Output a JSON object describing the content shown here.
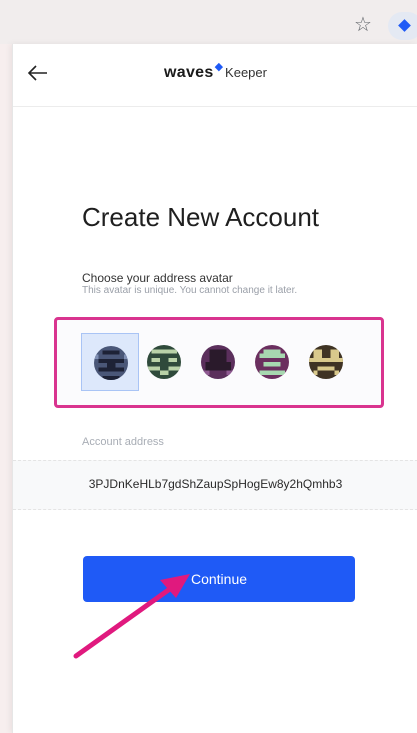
{
  "browser": {
    "icons": [
      "star-icon",
      "waves-extension-icon"
    ]
  },
  "header": {
    "back_icon": "arrow-left-icon",
    "logo_waves": "waves",
    "logo_keeper": "Keeper"
  },
  "main": {
    "title": "Create New Account",
    "avatar_label": "Choose your address avatar",
    "avatar_hint": "This avatar is unique. You cannot change it later.",
    "avatars": [
      {
        "selected": true
      },
      {
        "selected": false
      },
      {
        "selected": false
      },
      {
        "selected": false
      },
      {
        "selected": false
      }
    ],
    "address_label": "Account address",
    "address_value": "3PJDnKeHLb7gdShZaupSpHogEw8y2hQmhb3",
    "continue_label": "Continue"
  },
  "colors": {
    "accent": "#1f5af6",
    "highlight": "#d9348f"
  }
}
